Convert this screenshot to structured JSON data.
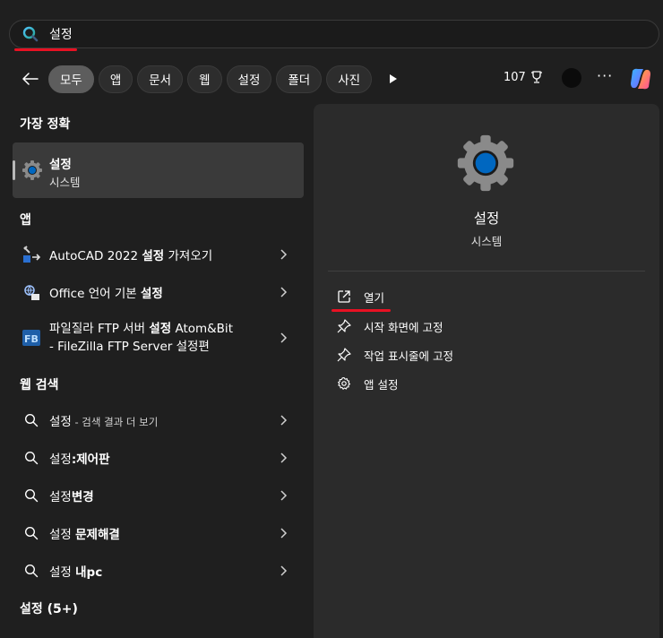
{
  "search": {
    "value": "설정"
  },
  "filters": {
    "chips": [
      "모두",
      "앱",
      "문서",
      "웹",
      "설정",
      "폴더",
      "사진"
    ],
    "points": "107"
  },
  "left": {
    "best_match_header": "가장 정확",
    "best_match": {
      "title": "설정",
      "subtitle": "시스템"
    },
    "apps_header": "앱",
    "apps": [
      {
        "pre": "AutoCAD 2022 ",
        "bold": "설정",
        "post": " 가져오기"
      },
      {
        "pre": "Office 언어 기본 ",
        "bold": "설정",
        "post": ""
      },
      {
        "pre": "파일질라 FTP 서버 ",
        "bold": "설정",
        "post": " Atom&Bit",
        "line2": "- FileZilla FTP Server 설정편"
      }
    ],
    "web_header": "웹 검색",
    "web": [
      {
        "pre": "설정",
        "bold": "",
        "sub": " - 검색 결과 더 보기"
      },
      {
        "pre": "설정",
        "bold": ":제어판",
        "sub": ""
      },
      {
        "pre": "설정",
        "bold": "변경",
        "sub": ""
      },
      {
        "pre": "설정 ",
        "bold": "문제해결",
        "sub": ""
      },
      {
        "pre": "설정 ",
        "bold": "내pc",
        "sub": ""
      }
    ],
    "settings_header": "설정 (5+)"
  },
  "right": {
    "title": "설정",
    "subtitle": "시스템",
    "actions": [
      {
        "label": "열기",
        "icon": "open-external-icon"
      },
      {
        "label": "시작 화면에 고정",
        "icon": "pin-icon"
      },
      {
        "label": "작업 표시줄에 고정",
        "icon": "pin-icon"
      },
      {
        "label": "앱 설정",
        "icon": "gear-icon"
      }
    ]
  },
  "colors": {
    "background": "#1f1f1f",
    "panel": "#2b2b2b",
    "selected": "#3a3a3a",
    "accent_red": "#e81123",
    "gear_blue": "#0067c0"
  }
}
